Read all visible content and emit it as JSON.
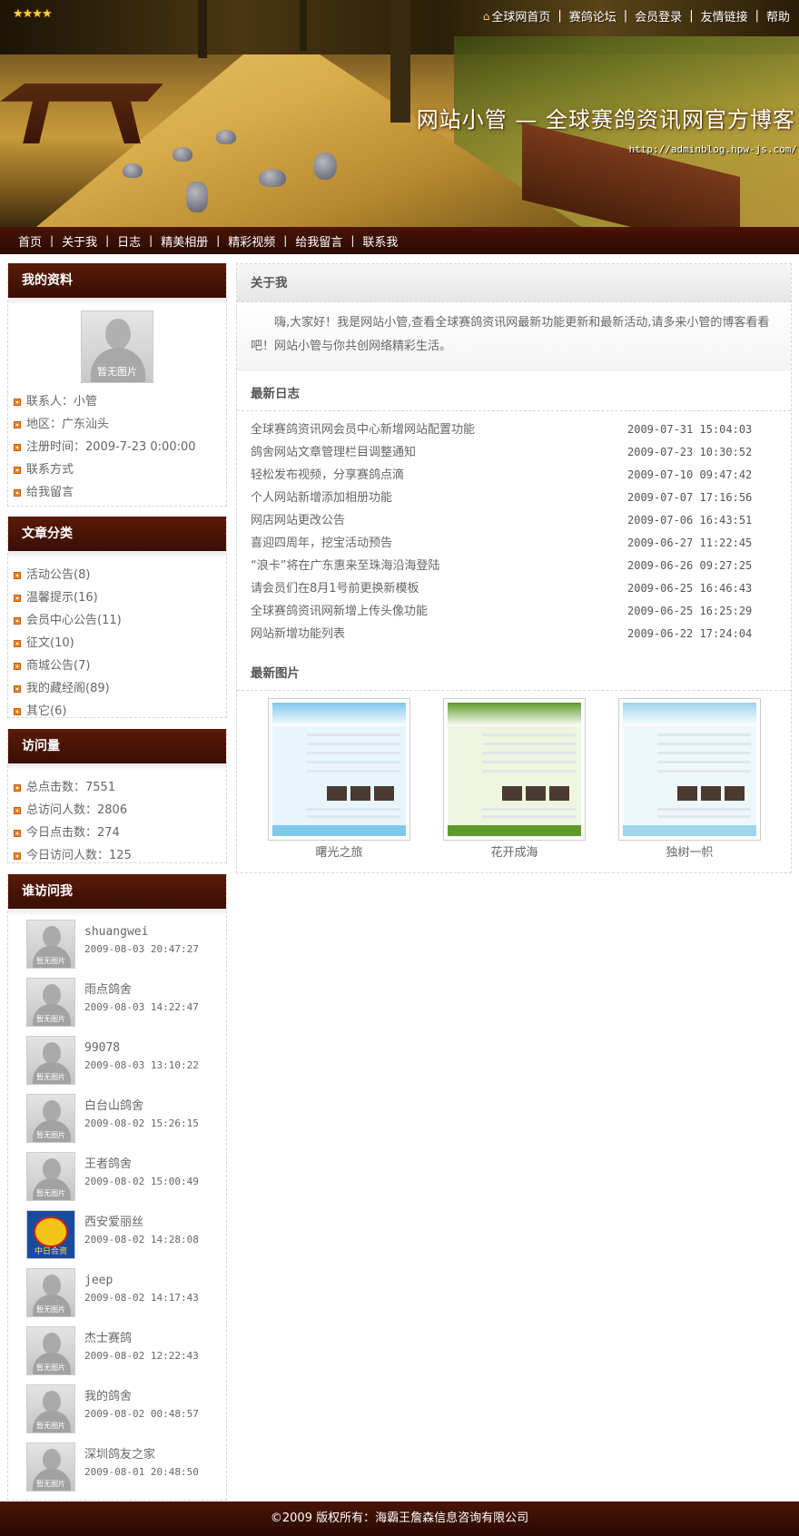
{
  "banner": {
    "title": "网站小管 — 全球赛鸽资讯网官方博客",
    "url": "http://adminblog.hpw-js.com/",
    "stars": "★★★★"
  },
  "top_links": [
    "全球网首页",
    "赛鸽论坛",
    "会员登录",
    "友情链接",
    "帮助"
  ],
  "nav": [
    "首页",
    "关于我",
    "日志",
    "精美相册",
    "精彩视频",
    "给我留言",
    "联系我"
  ],
  "profile": {
    "heading": "我的资料",
    "avatar_caption": "暂无图片",
    "items": [
      "联系人：小管",
      "地区：广东汕头",
      "注册时间：2009-7-23 0:00:00",
      "联系方式",
      "给我留言"
    ]
  },
  "categories": {
    "heading": "文章分类",
    "items": [
      "活动公告(8)",
      "温馨提示(16)",
      "会员中心公告(11)",
      "征文(10)",
      "商城公告(7)",
      "我的藏经阁(89)",
      "其它(6)"
    ]
  },
  "stats": {
    "heading": "访问量",
    "items": [
      "总点击数：7551",
      "总访问人数：2806",
      "今日点击数：274",
      "今日访问人数：125"
    ]
  },
  "visitors": {
    "heading": "谁访问我",
    "avatar_caption": "暂无图片",
    "logo_caption": "中日合资",
    "items": [
      {
        "name": "shuangwei",
        "time": "2009-08-03 20:47:27"
      },
      {
        "name": "雨点鸽舍",
        "time": "2009-08-03 14:22:47"
      },
      {
        "name": "99078",
        "time": "2009-08-03 13:10:22"
      },
      {
        "name": "白台山鸽舍",
        "time": "2009-08-02 15:26:15"
      },
      {
        "name": "王者鸽舍",
        "time": "2009-08-02 15:00:49"
      },
      {
        "name": "西安爱丽丝",
        "time": "2009-08-02 14:28:08"
      },
      {
        "name": "jeep",
        "time": "2009-08-02 14:17:43"
      },
      {
        "name": "杰士赛鸽",
        "time": "2009-08-02 12:22:43"
      },
      {
        "name": "我的鸽舍",
        "time": "2009-08-02 00:48:57"
      },
      {
        "name": "深圳鸽友之家",
        "time": "2009-08-01 20:48:50"
      }
    ]
  },
  "main": {
    "about_heading": "关于我",
    "about_text": "嗨,大家好！我是网站小管,查看全球赛鸽资讯网最新功能更新和最新活动,请多来小管的博客看看吧！网站小管与你共创网络精彩生活。",
    "logs_heading": "最新日志",
    "logs": [
      {
        "title": "全球赛鸽资讯网会员中心新增网站配置功能",
        "date": "2009-07-31 15:04:03"
      },
      {
        "title": "鸽舍网站文章管理栏目调整通知",
        "date": "2009-07-23 10:30:52"
      },
      {
        "title": "轻松发布视频，分享赛鸽点滴",
        "date": "2009-07-10 09:47:42"
      },
      {
        "title": "个人网站新增添加相册功能",
        "date": "2009-07-07 17:16:56"
      },
      {
        "title": "网店网站更改公告",
        "date": "2009-07-06 16:43:51"
      },
      {
        "title": "喜迎四周年，挖宝活动预告",
        "date": "2009-06-27 11:22:45"
      },
      {
        "title": "“浪卡”将在广东惠来至珠海沿海登陆",
        "date": "2009-06-26 09:27:25"
      },
      {
        "title": "请会员们在8月1号前更换新模板",
        "date": "2009-06-25 16:46:43"
      },
      {
        "title": "全球赛鸽资讯网新增上传头像功能",
        "date": "2009-06-25 16:25:29"
      },
      {
        "title": "网站新增功能列表",
        "date": "2009-06-22 17:24:04"
      }
    ],
    "pics_heading": "最新图片",
    "pics": [
      {
        "name": "曙光之旅",
        "theme": "#7ec8ec",
        "sidebar": "#e8f6fc"
      },
      {
        "name": "花开成海",
        "theme": "#5e9a2a",
        "sidebar": "#eef6e0"
      },
      {
        "name": "独树一帜",
        "theme": "#9ed4ee",
        "sidebar": "#eef8fc"
      }
    ]
  },
  "footer": "©2009 版权所有：海霸王詹森信息咨询有限公司"
}
